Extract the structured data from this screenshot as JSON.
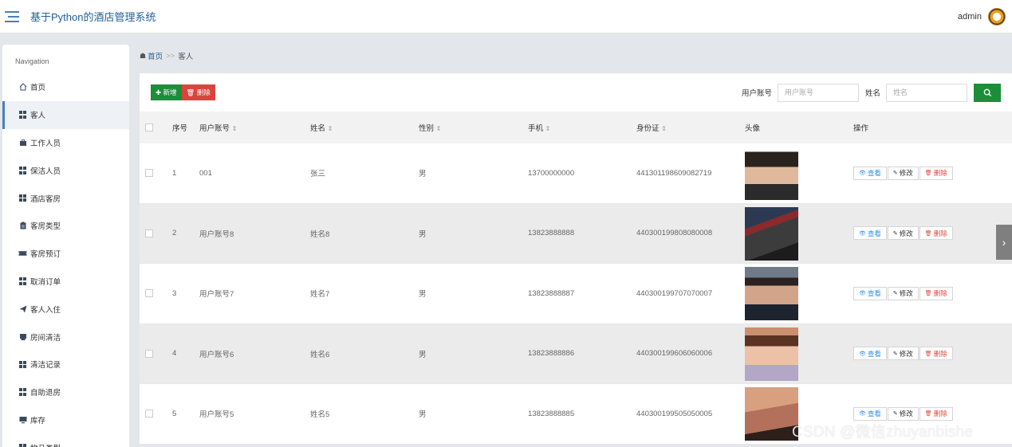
{
  "header": {
    "title": "基于Python的酒店管理系统",
    "username": "admin"
  },
  "sidebar": {
    "heading": "Navigation",
    "items": [
      {
        "label": "首页",
        "icon": "home-icon"
      },
      {
        "label": "客人",
        "icon": "grid-icon"
      },
      {
        "label": "工作人员",
        "icon": "briefcase-icon"
      },
      {
        "label": "保洁人员",
        "icon": "grid-icon"
      },
      {
        "label": "酒店客房",
        "icon": "grid-icon"
      },
      {
        "label": "客房类型",
        "icon": "clipboard-icon"
      },
      {
        "label": "客房预订",
        "icon": "ticket-icon"
      },
      {
        "label": "取消订单",
        "icon": "grid-icon"
      },
      {
        "label": "客人入住",
        "icon": "paper-plane-icon"
      },
      {
        "label": "房间清洁",
        "icon": "inbox-icon"
      },
      {
        "label": "清洁记录",
        "icon": "grid-icon"
      },
      {
        "label": "自助退房",
        "icon": "grid-icon"
      },
      {
        "label": "库存",
        "icon": "monitor-icon"
      },
      {
        "label": "物品类型",
        "icon": "grid-icon"
      }
    ]
  },
  "breadcrumb": {
    "home": "首页",
    "separator": ">>",
    "current": "客人"
  },
  "toolbar": {
    "add_label": "新增",
    "delete_label": "删除",
    "search_account_label": "用户账号",
    "search_account_placeholder": "用户账号",
    "search_name_label": "姓名",
    "search_name_placeholder": "姓名"
  },
  "table": {
    "headers": [
      "序号",
      "用户账号",
      "姓名",
      "性别",
      "手机",
      "身份证",
      "头像",
      "操作"
    ],
    "sort_arrow": "⇕",
    "rows": [
      {
        "index": "1",
        "account": "001",
        "name": "张三",
        "gender": "男",
        "phone": "13700000000",
        "id_card": "441301198609082719"
      },
      {
        "index": "2",
        "account": "用户账号8",
        "name": "姓名8",
        "gender": "男",
        "phone": "13823888888",
        "id_card": "440300199808080008"
      },
      {
        "index": "3",
        "account": "用户账号7",
        "name": "姓名7",
        "gender": "男",
        "phone": "13823888887",
        "id_card": "440300199707070007"
      },
      {
        "index": "4",
        "account": "用户账号6",
        "name": "姓名6",
        "gender": "男",
        "phone": "13823888886",
        "id_card": "440300199606060006"
      },
      {
        "index": "5",
        "account": "用户账号5",
        "name": "姓名5",
        "gender": "男",
        "phone": "13823888885",
        "id_card": "440300199505050005"
      }
    ],
    "actions": {
      "view": "查看",
      "edit": "修改",
      "delete": "删除"
    }
  },
  "watermark": "CSDN @微信zhuyanbishe",
  "colors": {
    "accent": "#1e8d3a",
    "danger": "#d9453c",
    "brand": "#1f5f9a"
  }
}
